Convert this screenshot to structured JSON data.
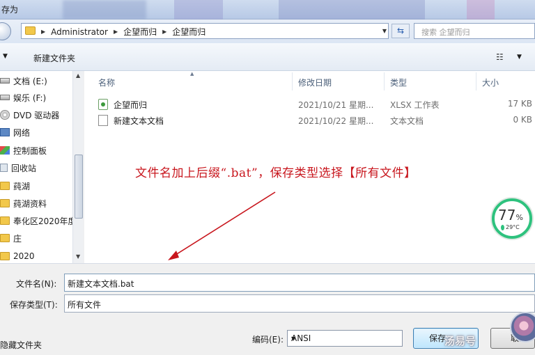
{
  "window": {
    "title": "存为"
  },
  "address": {
    "crumbs": [
      "Administrator",
      "企望而归",
      "企望而归"
    ],
    "search_placeholder": "搜索 企望而归"
  },
  "toolbar": {
    "new_folder": "新建文件夹"
  },
  "sidebar": {
    "items": [
      {
        "label": "文档 (E:)",
        "icon": "drive-icon"
      },
      {
        "label": "娱乐 (F:)",
        "icon": "drive-icon"
      },
      {
        "label": "DVD 驱动器",
        "icon": "dvd-icon"
      },
      {
        "label": "网络",
        "icon": "network-icon"
      },
      {
        "label": "控制面板",
        "icon": "control-panel-icon"
      },
      {
        "label": "回收站",
        "icon": "recycle-bin-icon"
      },
      {
        "label": "莼湖",
        "icon": "folder-icon"
      },
      {
        "label": "莼湖资料",
        "icon": "folder-icon"
      },
      {
        "label": "奉化区2020年度",
        "icon": "folder-icon"
      },
      {
        "label": "庄",
        "icon": "folder-icon"
      },
      {
        "label": "2020",
        "icon": "folder-icon"
      }
    ]
  },
  "filelist": {
    "columns": {
      "name": "名称",
      "date": "修改日期",
      "type": "类型",
      "size": "大小"
    },
    "rows": [
      {
        "name": "企望而归",
        "date": "2021/10/21 星期...",
        "type": "XLSX 工作表",
        "size": "17 KB",
        "icon": "xlsx-file-icon"
      },
      {
        "name": "新建文本文档",
        "date": "2021/10/22 星期...",
        "type": "文本文档",
        "size": "0 KB",
        "icon": "text-file-icon"
      }
    ]
  },
  "annotation": "文件名加上后缀“.bat”，保存类型选择【所有文件】",
  "gauge": {
    "percent": "77",
    "percent_sign": "%",
    "temp": "29°C"
  },
  "form": {
    "filename_label": "文件名(N):",
    "filename_value": "新建文本文档.bat",
    "filetype_label": "保存类型(T):",
    "filetype_value": "所有文件",
    "hide_folders": "隐藏文件夹",
    "encoding_label": "编码(E):",
    "encoding_value": "ANSI",
    "save_label": "保存",
    "cancel_label": "取消"
  },
  "watermark": "汤易号",
  "colors": {
    "annotation": "#c8161d",
    "gauge": "#2ec27e",
    "accent": "#3c7fb1"
  }
}
